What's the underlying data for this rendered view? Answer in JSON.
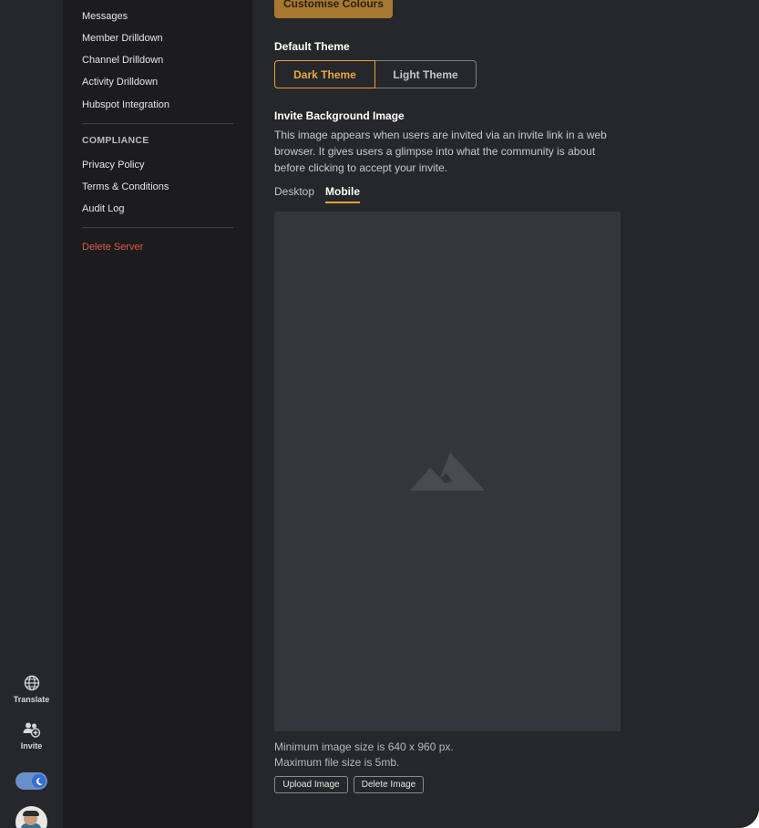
{
  "rail": {
    "translate_label": "Translate",
    "invite_label": "Invite",
    "icons": [
      "globe-icon",
      "add-users-icon",
      "moon-icon"
    ]
  },
  "sidebar": {
    "items_top": [
      "Messages",
      "Member Drilldown",
      "Channel Drilldown",
      "Activity Drilldown",
      "Hubspot Integration"
    ],
    "compliance_heading": "COMPLIANCE",
    "compliance_items": [
      "Privacy Policy",
      "Terms & Conditions",
      "Audit Log"
    ],
    "delete_server": "Delete Server"
  },
  "main": {
    "customise_colours": "Customise Colours",
    "default_theme_title": "Default Theme",
    "theme_options": [
      "Dark Theme",
      "Light Theme"
    ],
    "selected_theme": "Dark Theme",
    "invite_bg_title": "Invite Background Image",
    "invite_bg_desc": "This image appears when users are invited via an invite link in a web browser. It gives users a glimpse into what the community is about before clicking to accept your invite.",
    "tabs": [
      "Desktop",
      "Mobile"
    ],
    "active_tab": "Mobile",
    "placeholder_icon": "image-placeholder-icon",
    "min_size_text": "Minimum image size is 640 x 960 px.",
    "max_file_text": "Maximum file size is 5mb.",
    "upload_label": "Upload Image",
    "delete_label": "Delete Image"
  },
  "colors": {
    "accent": "#e4a23a",
    "danger": "#e2574c",
    "background": "#26272b",
    "sidebar": "#1c1c1f"
  }
}
